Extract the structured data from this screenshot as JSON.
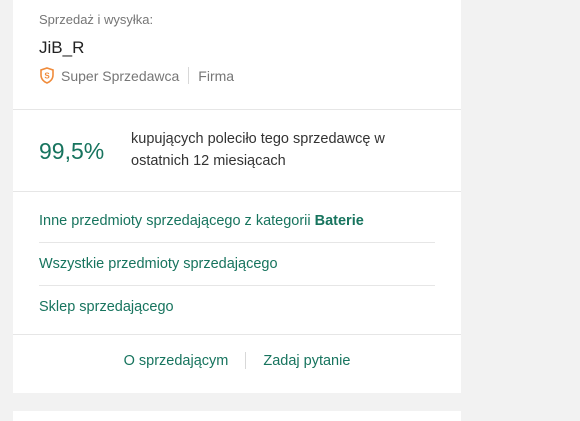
{
  "seller": {
    "section_label": "Sprzedaż i wysyłka:",
    "name": "JiB_R",
    "badge_label": "Super Sprzedawca",
    "type_label": "Firma",
    "badge_icon": "super-seller-shield-icon"
  },
  "rating": {
    "value": "99,5%",
    "text": "kupujących poleciło tego sprzedawcę w ostatnich 12 miesiącach"
  },
  "links": {
    "category_items_prefix": "Inne przedmioty sprzedającego z kategorii",
    "category_name": "Baterie",
    "all_items": "Wszystkie przedmioty sprzedającego",
    "store": "Sklep sprzedającego"
  },
  "footer": {
    "about_seller": "O sprzedającym",
    "ask_question": "Zadaj pytanie"
  },
  "colors": {
    "accent": "#17745e",
    "badge": "#f08b3b"
  }
}
